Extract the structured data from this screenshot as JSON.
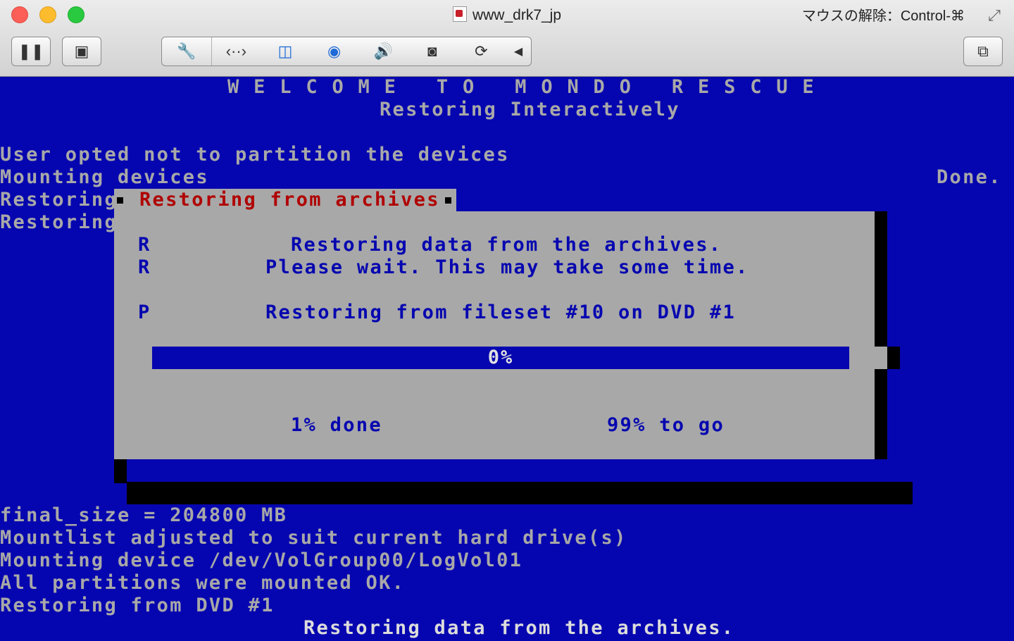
{
  "window": {
    "title": "www_drk7_jp",
    "release_hint": "マウスの解除：Control-⌘"
  },
  "toolbar": {
    "pause_label": "❚❚",
    "display_label": "▣",
    "wrench_label": "🔧",
    "code_label": "‹··›",
    "disk_label": "◫",
    "cd_label": "◉",
    "sound_label": "🔊",
    "camera_label": "◙",
    "sync_label": "⟳",
    "collapse_label": "◀",
    "window_label": "⧉"
  },
  "terminal": {
    "banner": "W E L C O M E   T O   M O N D O   R E S C U E",
    "subtitle": "Restoring Interactively",
    "line_partition": "User opted not to partition the devices",
    "line_mounting": "Mounting devices",
    "line_done": "Done.",
    "line_restoring_1": "Restoring",
    "line_restoring_2": "Restoring",
    "line_final_size": "final_size = 204800 MB",
    "line_mountlist": "Mountlist adjusted to suit current hard drive(s)",
    "line_mount_device": "Mounting device /dev/VolGroup00/LogVol01",
    "line_all_mounted": "All partitions were mounted OK.",
    "line_restoring_dvd": "Restoring from DVD #1",
    "status_line": "Restoring data from the archives."
  },
  "dialog": {
    "title": "Restoring from archives",
    "left_r1": "R",
    "left_r2": "R",
    "left_p": "P",
    "msg1": "Restoring data from the archives.",
    "msg2": "Please wait. This may take some time.",
    "msg3": "Restoring from fileset #10 on DVD #1",
    "progress_label": "0%",
    "progress_value": 0,
    "done_text": "1% done",
    "togo_text": "99% to go"
  },
  "colors": {
    "terminal_bg": "#0606b0",
    "terminal_fg": "#a8a8a8",
    "dialog_bg": "#a8a8a8",
    "dialog_title": "#b00000",
    "dialog_fg": "#0606b0"
  },
  "icons": [
    "close-icon",
    "minimize-icon",
    "zoom-icon",
    "document-icon",
    "fullscreen-icon",
    "pause-icon",
    "display-icon",
    "wrench-icon",
    "code-icon",
    "disk-icon",
    "cd-icon",
    "sound-icon",
    "camera-icon",
    "sync-icon",
    "collapse-arrow-icon",
    "window-icon"
  ]
}
